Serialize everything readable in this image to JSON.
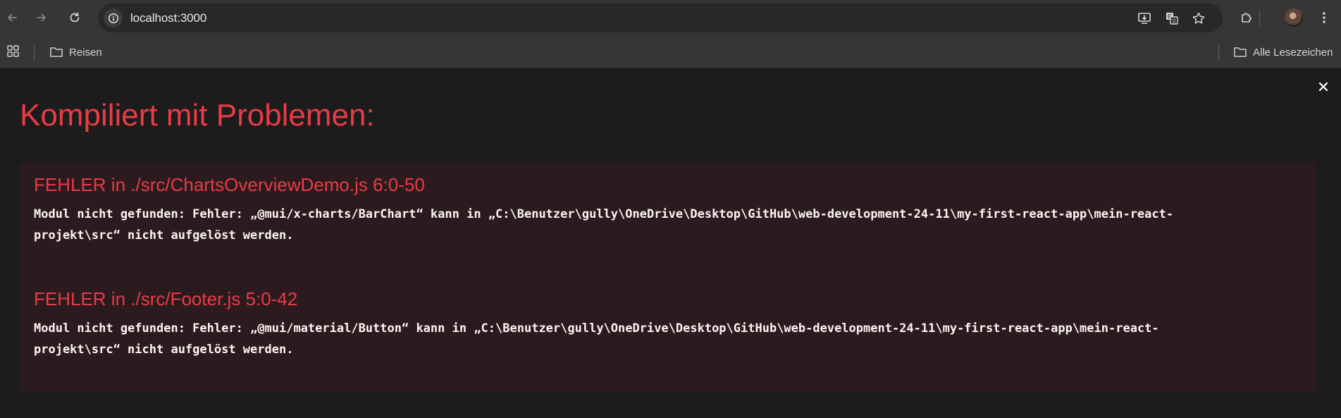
{
  "browser": {
    "url": "localhost:3000",
    "icons": {
      "back": "arrow-left-icon",
      "forward": "arrow-right-icon",
      "reload": "reload-icon",
      "site_info": "info-icon",
      "install": "install-app-icon",
      "translate": "translate-icon",
      "bookmark": "star-icon",
      "extensions": "puzzle-icon",
      "menu": "kebab-menu-icon"
    }
  },
  "bookmarks_bar": {
    "items": [
      {
        "label": "Reisen",
        "icon": "folder-icon"
      }
    ],
    "all_bookmarks": {
      "label": "Alle Lesezeichen",
      "icon": "folder-icon"
    }
  },
  "overlay": {
    "title": "Kompiliert mit Problemen:",
    "close_symbol": "✕",
    "errors": [
      {
        "heading": "FEHLER in ./src/ChartsOverviewDemo.js 6:0-50",
        "message_line1": "Modul nicht gefunden: Fehler: „@mui/x-charts/BarChart“ kann in „C:\\Benutzer\\gully\\OneDrive\\Desktop\\GitHub\\web-development-24-11\\my-first-react-app\\mein-react-",
        "message_line2": "projekt\\src“ nicht aufgelöst werden."
      },
      {
        "heading": "FEHLER in ./src/Footer.js 5:0-42",
        "message_line1": "Modul nicht gefunden: Fehler: „@mui/material/Button“ kann in „C:\\Benutzer\\gully\\OneDrive\\Desktop\\GitHub\\web-development-24-11\\my-first-react-app\\mein-react-",
        "message_line2": "projekt\\src“ nicht aufgelöst werden."
      }
    ]
  },
  "colors": {
    "error_red": "#e83b46",
    "panel_bg": "#2c1b1e",
    "page_bg": "#1c1c1c",
    "chrome_bg": "#363636"
  }
}
